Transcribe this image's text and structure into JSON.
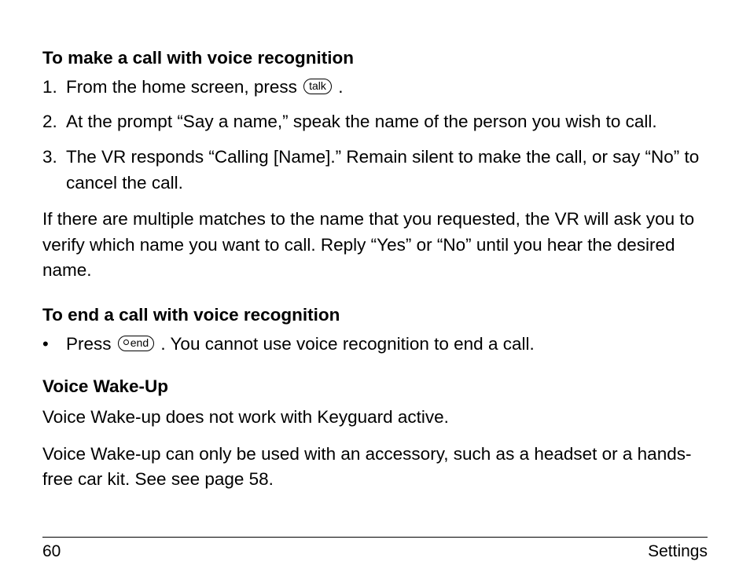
{
  "headings": {
    "make_call": "To make a call with voice recognition",
    "end_call": "To end a call with voice recognition",
    "voice_wake": "Voice Wake-Up"
  },
  "steps": {
    "s1_pre": "From the home screen, press ",
    "s1_post": " .",
    "s2": "At the prompt “Say a name,” speak the name of the person you wish to call.",
    "s3": "The VR responds “Calling [Name].” Remain silent to make the call, or say “No” to cancel the call."
  },
  "para_multiple": "If there are multiple matches to the name that you requested, the VR will ask you to verify which name you want to call. Reply “Yes” or “No” until you hear the desired name.",
  "end_call_bullet": {
    "pre": "Press ",
    "post": ". You cannot use voice recognition to end a call."
  },
  "voice_wake_paras": {
    "p1": "Voice Wake-up does not work with Keyguard active.",
    "p2": "Voice Wake-up can only be used with an accessory, such as a headset or a hands-free car kit. See see page 58."
  },
  "keys": {
    "talk": "talk",
    "end": "end"
  },
  "footer": {
    "page": "60",
    "section": "Settings"
  }
}
